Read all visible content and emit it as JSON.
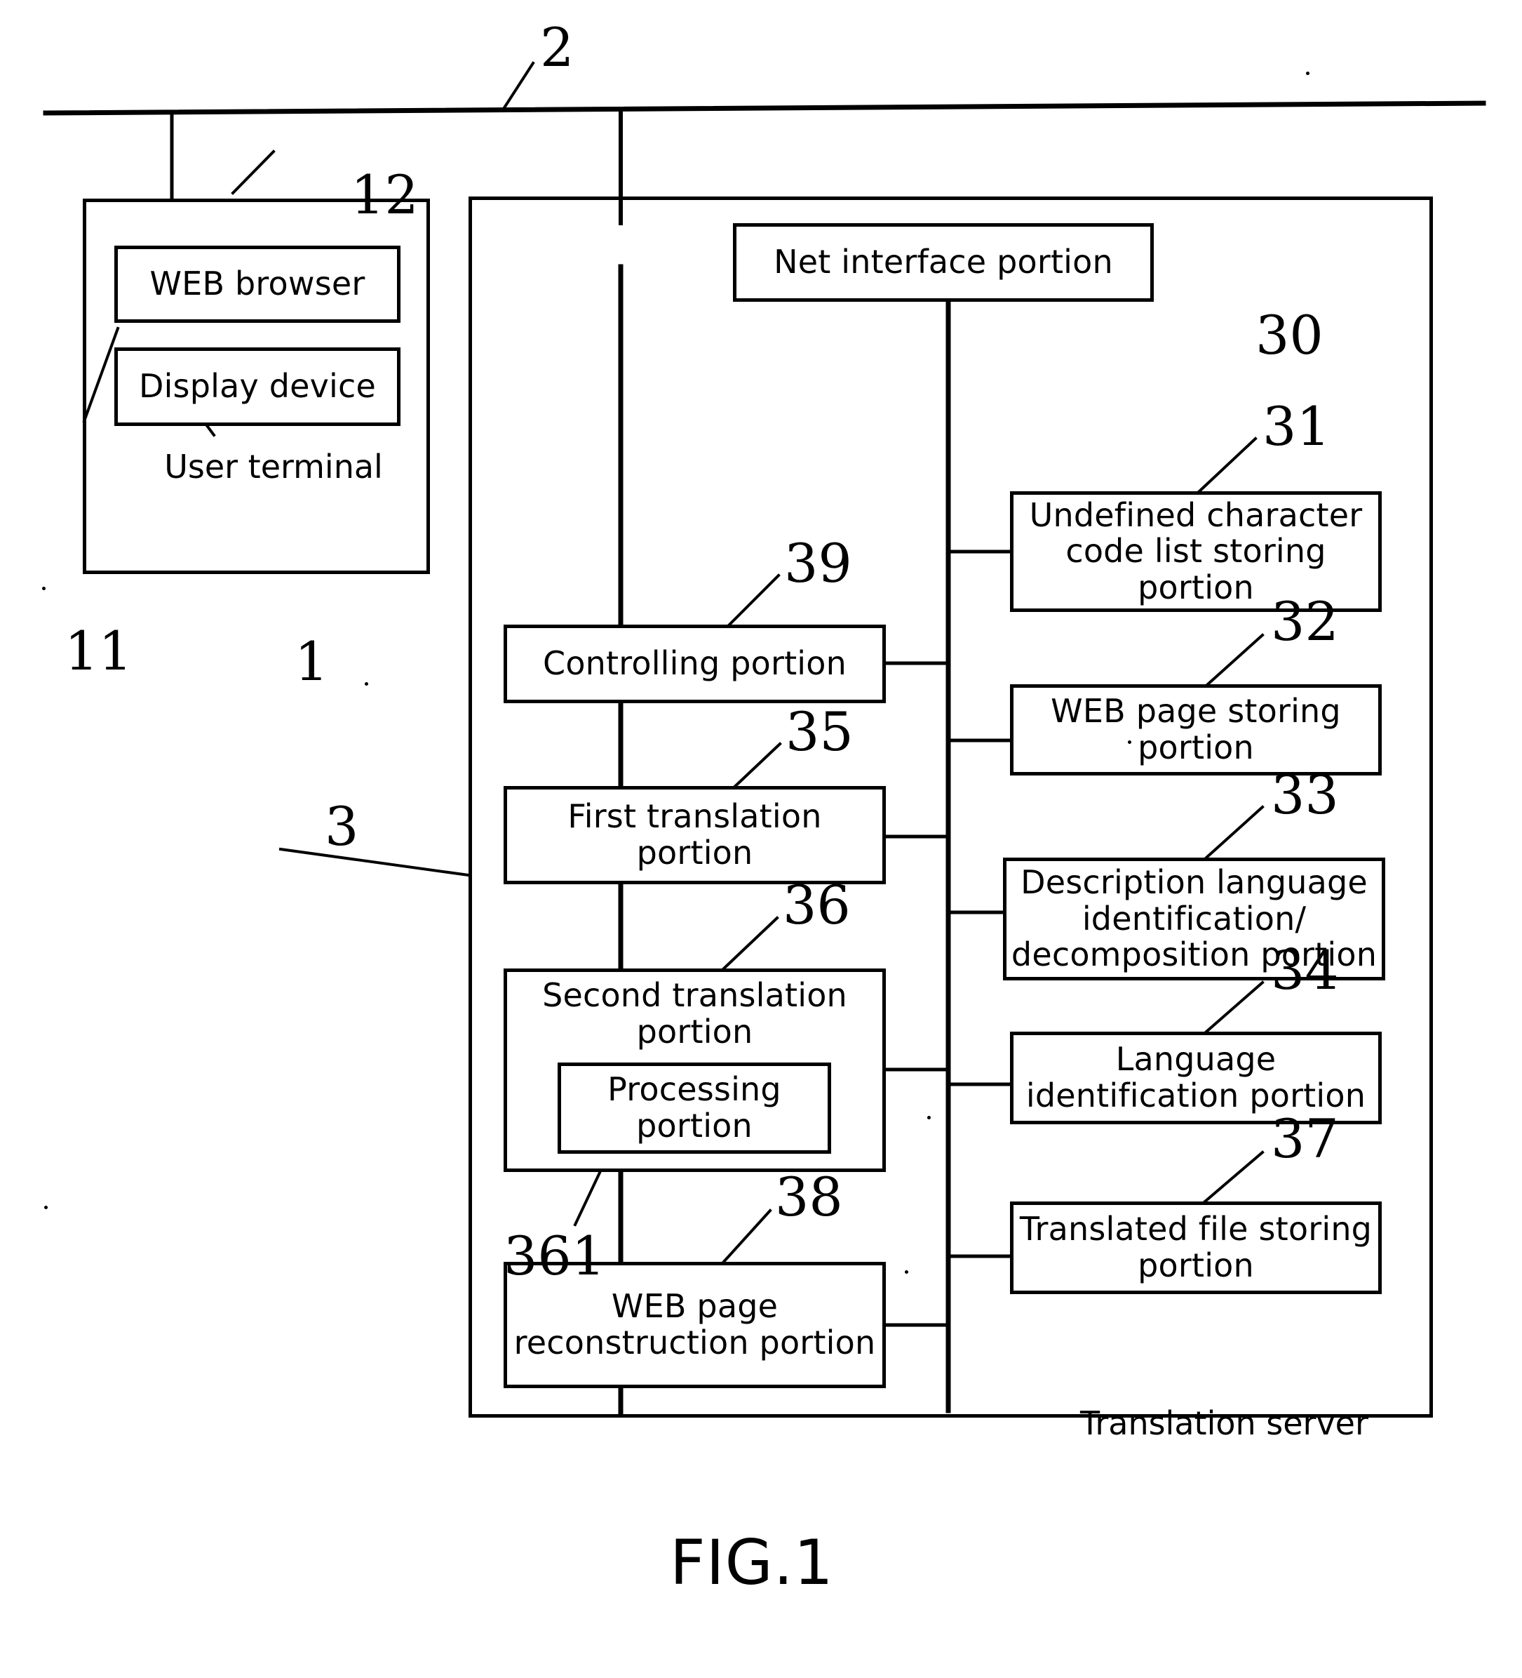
{
  "figure": {
    "caption": "FIG.1",
    "network_label": "2",
    "user_terminal": {
      "title": "User terminal",
      "ref": "1",
      "display_device_ref": "11",
      "web_browser_ref": "12",
      "boxes": [
        {
          "label": "WEB browser",
          "ref": "12"
        },
        {
          "label": "Display device",
          "ref": "11"
        }
      ]
    },
    "translation_server": {
      "title": "Translation server",
      "ref": "3",
      "net_interface": {
        "label": "Net interface portion",
        "ref": "30"
      },
      "left_column": [
        {
          "label": "Controlling portion",
          "ref": "39"
        },
        {
          "label": "First translation portion",
          "ref": "35"
        },
        {
          "label": "Second translation portion",
          "ref": "36",
          "inner": {
            "label": "Processing portion",
            "ref": "361"
          }
        },
        {
          "label": "WEB page reconstruction portion",
          "ref": "38"
        }
      ],
      "right_column": [
        {
          "label": "Undefined character code list storing portion",
          "ref": "31"
        },
        {
          "label": "WEB page storing portion",
          "ref": "32"
        },
        {
          "label": "Description language identification/ decomposition portion",
          "ref": "33"
        },
        {
          "label": "Language identification portion",
          "ref": "34"
        },
        {
          "label": "Translated file storing portion",
          "ref": "37"
        }
      ]
    }
  },
  "colors": {
    "line": "#000000",
    "background": "#ffffff"
  }
}
